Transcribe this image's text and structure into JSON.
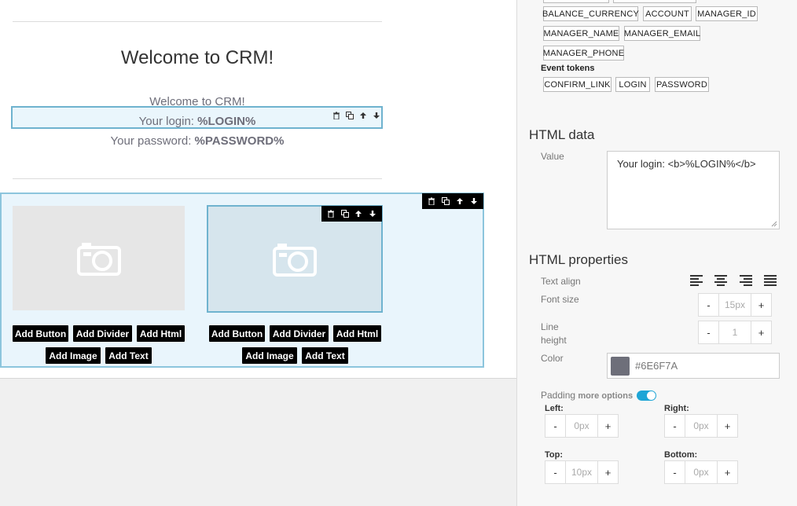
{
  "canvas": {
    "heading": "Welcome to CRM!",
    "line1": "Welcome to CRM!",
    "login_prefix": "Your login: ",
    "login_token": "%LOGIN%",
    "password_prefix": "Your password: ",
    "password_token": "%PASSWORD%",
    "columns": [
      {
        "buttons": [
          "Add Button",
          "Add Divider",
          "Add Html",
          "Add Image",
          "Add Text"
        ]
      },
      {
        "buttons": [
          "Add Button",
          "Add Divider",
          "Add Html",
          "Add Image",
          "Add Text"
        ]
      }
    ]
  },
  "panel": {
    "tokens_row1": [
      "BALANCE_CURRENCY",
      "ACCOUNT",
      "MANAGER_ID"
    ],
    "tokens_row2": [
      "MANAGER_NAME",
      "MANAGER_EMAIL"
    ],
    "tokens_row3": [
      "MANAGER_PHONE"
    ],
    "event_tokens_label": "Event tokens",
    "event_tokens": [
      "CONFIRM_LINK",
      "LOGIN",
      "PASSWORD"
    ],
    "html_data_title": "HTML data",
    "value_label": "Value",
    "value_text": "Your login: <b>%LOGIN%</b>",
    "html_properties_title": "HTML properties",
    "text_align_label": "Text align",
    "font_size_label": "Font size",
    "font_size_value": "15px",
    "line_height_label_1": "Line",
    "line_height_label_2": "height",
    "line_height_value": "1",
    "color_label": "Color",
    "color_value": "#6E6F7A",
    "padding_label": "Padding",
    "more_options_label": "more options",
    "left_label": "Left:",
    "left_value": "0px",
    "right_label": "Right:",
    "right_value": "0px",
    "top_label": "Top:",
    "top_value": "10px",
    "bottom_label": "Bottom:",
    "bottom_value": "0px",
    "minus": "-",
    "plus": "+"
  },
  "colors": {
    "accent": "#1ea5d6",
    "text_color": "#6E6F7A",
    "selection": "#6fb3cf"
  }
}
